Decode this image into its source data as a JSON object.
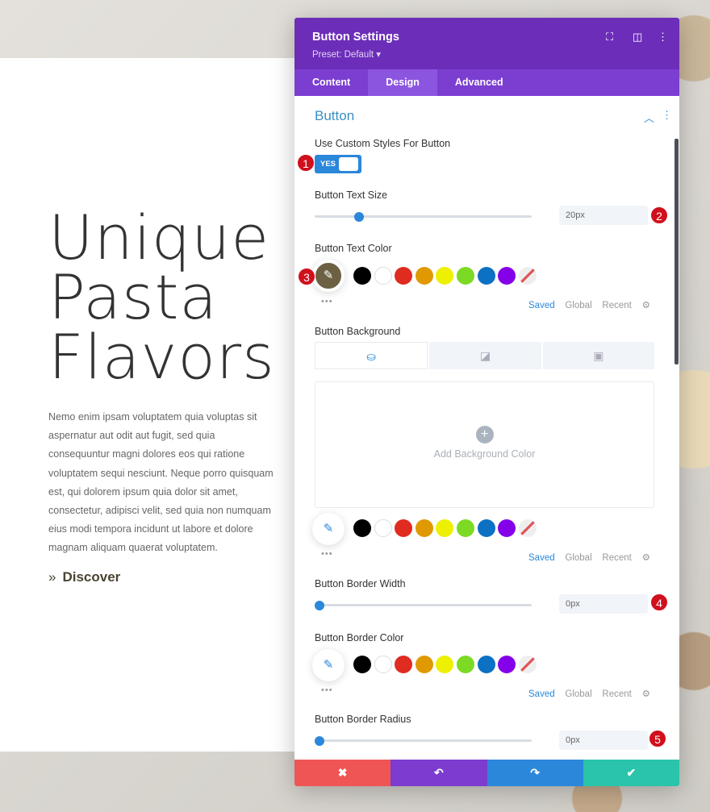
{
  "page": {
    "hero_lines": [
      "Unique",
      "Pasta",
      "Flavors"
    ],
    "body": "Nemo enim ipsam voluptatem quia voluptas sit aspernatur aut odit aut fugit, sed quia consequuntur magni dolores eos qui ratione voluptatem sequi nesciunt. Neque porro quisquam est, qui dolorem ipsum quia dolor sit amet, consectetur, adipisci velit, sed quia non numquam eius modi tempora incidunt ut labore et dolore magnam aliquam quaerat voluptatem.",
    "link_arrow": "»",
    "link": "Discover"
  },
  "panel": {
    "title": "Button Settings",
    "preset": "Preset: Default ▾",
    "tabs": [
      "Content",
      "Design",
      "Advanced"
    ],
    "active_tab": "Design",
    "section": "Button",
    "custom_styles": {
      "label": "Use Custom Styles For Button",
      "value": "YES"
    },
    "text_size": {
      "label": "Button Text Size",
      "value": "20px",
      "slider_fraction": 0.2
    },
    "text_color": {
      "label": "Button Text Color",
      "selected": "#6c6243"
    },
    "background": {
      "label": "Button Background",
      "add_label": "Add Background Color",
      "plus": "+"
    },
    "border_width": {
      "label": "Button Border Width",
      "value": "0px",
      "slider_fraction": 0
    },
    "border_color": {
      "label": "Button Border Color"
    },
    "border_radius": {
      "label": "Button Border Radius",
      "value": "0px",
      "slider_fraction": 0
    },
    "palette": {
      "swatches": [
        "#000000",
        "#ffffff",
        "#e02b20",
        "#e09900",
        "#edf000",
        "#7cda24",
        "#0c71c3",
        "#8300e9"
      ],
      "saved": "Saved",
      "global": "Global",
      "recent": "Recent",
      "dots": "•••"
    },
    "badges": [
      "1",
      "2",
      "3",
      "4",
      "5"
    ],
    "footer": {
      "colors": [
        "#ef5555",
        "#7d3bcf",
        "#2b87da",
        "#29c4a9"
      ],
      "icons": [
        "✖",
        "↶",
        "↷",
        "✔"
      ]
    }
  }
}
